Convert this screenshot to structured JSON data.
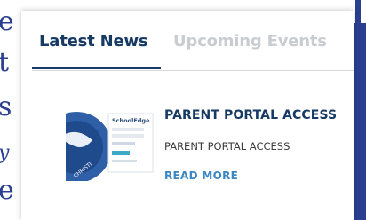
{
  "background": {
    "left_letters": [
      "e",
      "t",
      "s",
      "y",
      "e"
    ]
  },
  "tabs": {
    "latest_label": "Latest News",
    "upcoming_label": "Upcoming Events"
  },
  "news": [
    {
      "title": "PARENT PORTAL ACCESS",
      "summary": "PARENT PORTAL ACCESS",
      "link_label": "READ MORE",
      "thumbnail": {
        "app_name": "SchoolEdge",
        "seal_text": "CHRISTI"
      }
    }
  ],
  "colors": {
    "brand_navy": "#163a63",
    "tab_inactive": "#c9ccd0",
    "link_blue": "#3c86c4",
    "background_navy": "#2a3f8f"
  }
}
